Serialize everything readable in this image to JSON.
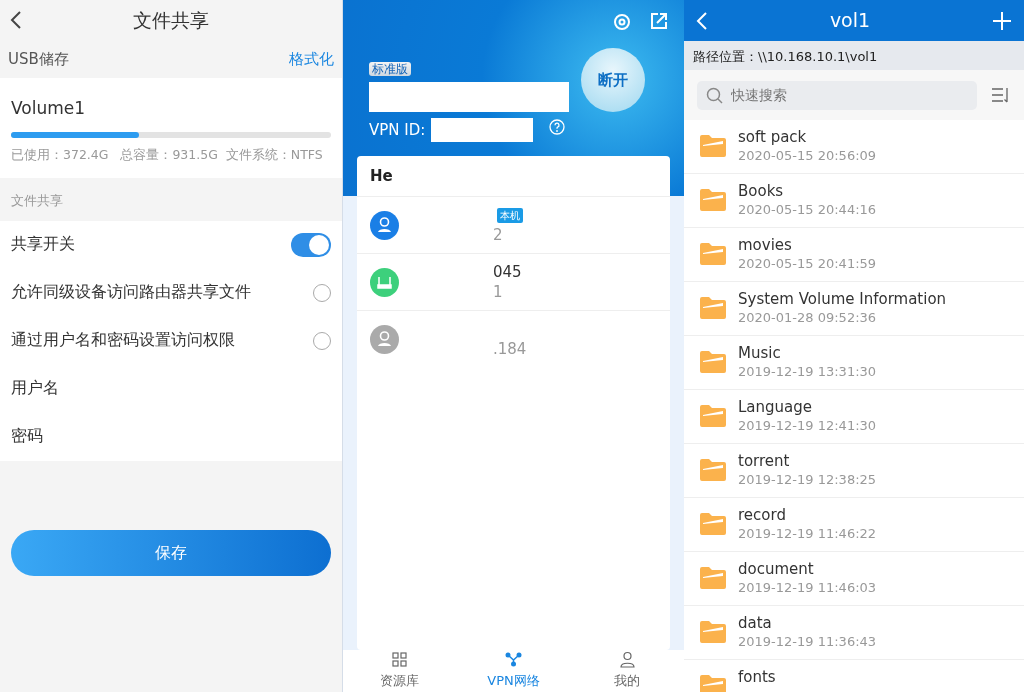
{
  "file_sharing": {
    "title": "文件共享",
    "section_storage": "USB储存",
    "format_link": "格式化",
    "volume": {
      "name": "Volume1",
      "level": 0.4,
      "stats": "已使用：372.4G   总容量：931.5G  文件系统：NTFS"
    },
    "section_share": "文件共享",
    "settings": [
      {
        "kind": "toggle",
        "label": "共享开关",
        "checked": true
      },
      {
        "kind": "radio",
        "label": "允许同级设备访问路由器共享文件",
        "checked": false
      },
      {
        "kind": "radio",
        "label": "通过用户名和密码设置访问权限",
        "checked": false
      },
      {
        "kind": "text",
        "label": "用户名"
      },
      {
        "kind": "text",
        "label": "密码"
      }
    ],
    "save_button": "保存"
  },
  "vpn": {
    "edition_badge": "标准版",
    "disconnect_button": "断开",
    "vpn_id_label": "VPN ID:",
    "network_name": "He",
    "devices": [
      {
        "kind": "self",
        "badge": "本机",
        "address": "2"
      },
      {
        "kind": "router",
        "name": "045",
        "address": "1"
      },
      {
        "kind": "peer",
        "address": ".184"
      }
    ],
    "nav": [
      {
        "kind": "grid",
        "label": "资源库",
        "selected": false
      },
      {
        "kind": "network",
        "label": "VPN网络",
        "selected": true
      },
      {
        "kind": "person",
        "label": "我的",
        "selected": false
      }
    ]
  },
  "file_browser": {
    "title": "vol1",
    "path": "路径位置：\\\\10.168.10.1\\vol1",
    "search": {
      "placeholder": "快速搜索"
    },
    "folders": [
      {
        "name": "soft pack",
        "date": "2020-05-15 20:56:09"
      },
      {
        "name": "Books",
        "date": "2020-05-15 20:44:16"
      },
      {
        "name": "movies",
        "date": "2020-05-15 20:41:59"
      },
      {
        "name": "System Volume Information",
        "date": "2020-01-28 09:52:36"
      },
      {
        "name": "Music",
        "date": "2019-12-19 13:31:30"
      },
      {
        "name": "Language",
        "date": "2019-12-19 12:41:30"
      },
      {
        "name": "torrent",
        "date": "2019-12-19 12:38:25"
      },
      {
        "name": "record",
        "date": "2019-12-19 11:46:22"
      },
      {
        "name": "document",
        "date": "2019-12-19 11:46:03"
      },
      {
        "name": "data",
        "date": "2019-12-19 11:36:43"
      },
      {
        "name": "fonts"
      }
    ]
  }
}
